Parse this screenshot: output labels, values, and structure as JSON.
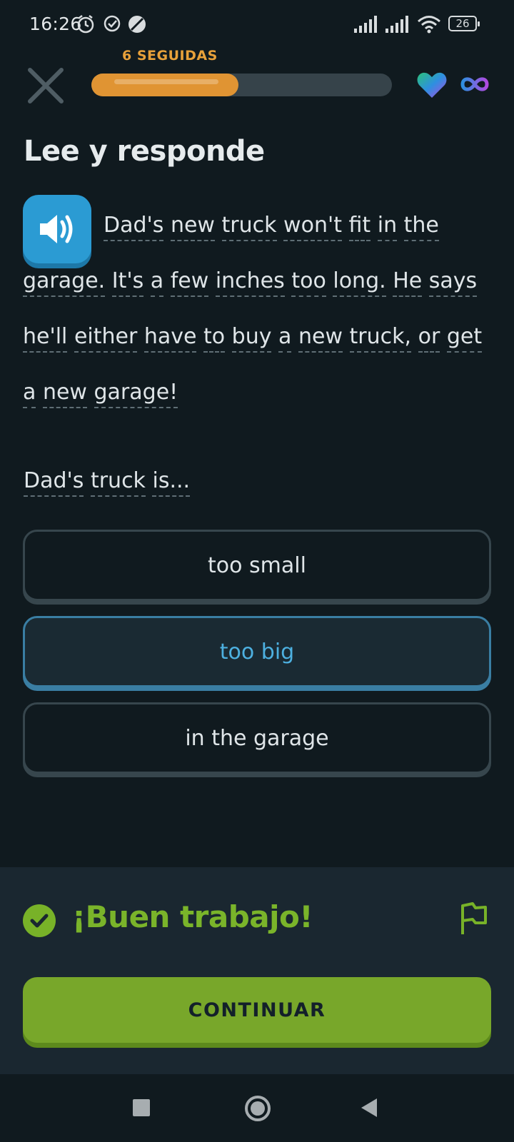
{
  "status_bar": {
    "time": "16:26",
    "battery": "26"
  },
  "header": {
    "streak_label": "6 SEGUIDAS",
    "progress_fraction": 0.49
  },
  "exercise": {
    "title": "Lee y responde",
    "passage_lines": [
      [
        "Dad's",
        "new",
        "truck",
        "won't",
        "fit",
        "in",
        "the"
      ],
      [
        "garage.",
        "It's",
        "a",
        "few",
        "inches",
        "too",
        "long.",
        "He",
        "says"
      ],
      [
        "he'll",
        "either",
        "have",
        "to",
        "buy",
        "a",
        "new",
        "truck,",
        "or",
        "get"
      ],
      [
        "a",
        "new",
        "garage!"
      ]
    ],
    "question_words": [
      "Dad's",
      "truck",
      "is..."
    ],
    "options": [
      {
        "label": "too small",
        "selected": false
      },
      {
        "label": "too big",
        "selected": true
      },
      {
        "label": "in the garage",
        "selected": false
      }
    ]
  },
  "feedback": {
    "title": "¡Buen trabajo!",
    "continue_label": "CONTINUAR"
  },
  "colors": {
    "accent_green": "#78b228",
    "accent_blue": "#2b9bd3",
    "streak_orange": "#e09433"
  },
  "icons": [
    "alarm-icon",
    "check-circle-icon",
    "no-data-icon",
    "signal-icon",
    "wifi-icon",
    "close-icon",
    "heart-icon",
    "infinity-icon",
    "speaker-icon",
    "check-icon",
    "flag-icon"
  ]
}
